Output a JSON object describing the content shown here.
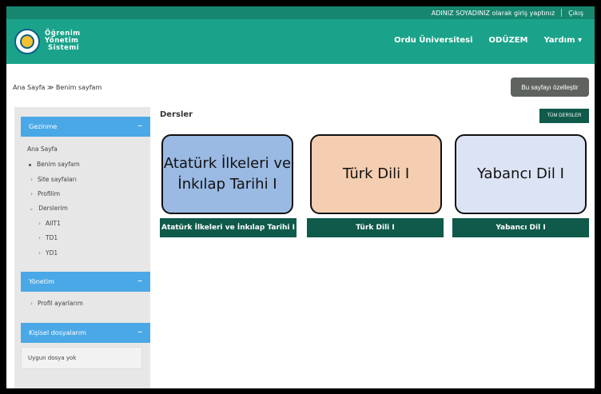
{
  "topbar": {
    "login_text": "ADINIZ SOYADINIZ olarak giriş yaptınız",
    "logout": "Çıkış"
  },
  "header": {
    "brand_lines": [
      "Öğrenim",
      "Yönetim",
      "Sistemi"
    ],
    "nav": [
      "Ordu Üniversitesi",
      "ODÜZEM",
      "Yardım ▾"
    ]
  },
  "breadcrumb": "Ana Sayfa ≫ Benim sayfam",
  "customize_button": "Bu sayfayı özelleştir",
  "sidebar": {
    "navigation": {
      "title": "Gezinme",
      "collapse": "–",
      "home": "Ana Sayfa",
      "items": [
        {
          "label": "Benim sayfam",
          "marker": "dot"
        },
        {
          "label": "Site sayfaları",
          "marker": "chev"
        },
        {
          "label": "Profilim",
          "marker": "chev"
        },
        {
          "label": "Derslerim",
          "marker": "chev-open"
        }
      ],
      "courses": [
        "AIIT1",
        "TD1",
        "YD1"
      ]
    },
    "admin": {
      "title": "Yönetim",
      "collapse": "–",
      "items": [
        "Profil ayarlarım"
      ]
    },
    "files": {
      "title": "Kişisel dosyalarım",
      "collapse": "–",
      "empty": "Uygun dosya yok"
    }
  },
  "main": {
    "title": "Dersler",
    "all_courses": "TÜM DERSLER",
    "courses": [
      {
        "image_text": "Atatürk İlkeleri ve İnkılap Tarihi I",
        "name": "Atatürk İlkeleri ve İnkılap Tarihi I",
        "color": "#9ab9e3"
      },
      {
        "image_text": "Türk Dili I",
        "name": "Türk Dili I",
        "color": "#f5cdb0"
      },
      {
        "image_text": "Yabancı Dil I",
        "name": "Yabancı Dil I",
        "color": "#dce3f4"
      }
    ]
  },
  "colors": {
    "header": "#1aa38a",
    "topbar": "#17866f",
    "course_bar": "#0f5a4a",
    "sidebar_head": "#4aa8e6"
  }
}
